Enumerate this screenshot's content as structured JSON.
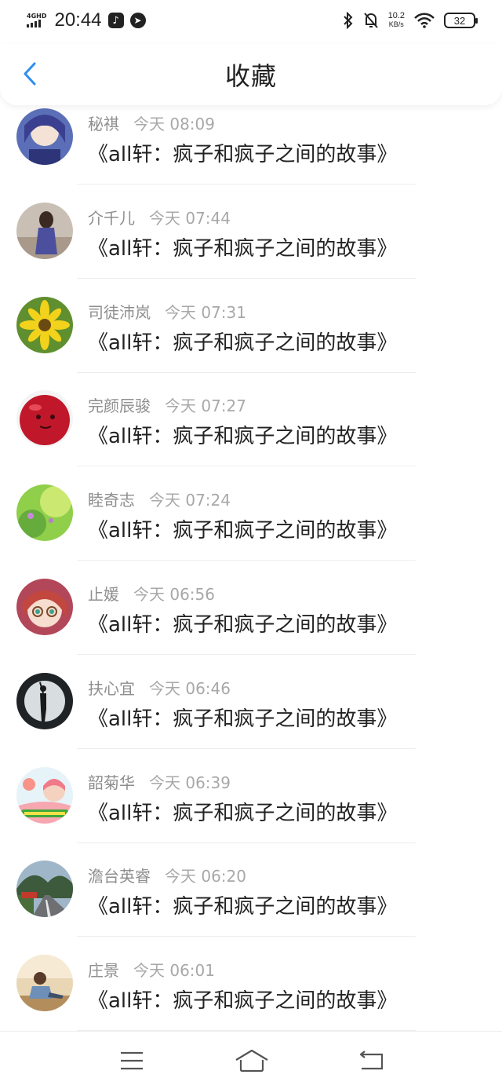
{
  "status_bar": {
    "network": "4GHD",
    "time": "20:44",
    "app_icon_1": "tiktok-icon",
    "app_icon_2": "navigation-app-icon",
    "net_speed_value": "10.2",
    "net_speed_unit": "KB/s",
    "battery": "32"
  },
  "header": {
    "title": "收藏",
    "back_icon": "chevron-left-icon",
    "accent_color": "#2f8ef0"
  },
  "items": [
    {
      "name": "秘祺",
      "time": "今天 08:09",
      "title": "《all轩：疯子和疯子之间的故事》"
    },
    {
      "name": "介千儿",
      "time": "今天 07:44",
      "title": "《all轩：疯子和疯子之间的故事》"
    },
    {
      "name": "司徒沛岚",
      "time": "今天 07:31",
      "title": "《all轩：疯子和疯子之间的故事》"
    },
    {
      "name": "完颜辰骏",
      "time": "今天 07:27",
      "title": "《all轩：疯子和疯子之间的故事》"
    },
    {
      "name": "睦奇志",
      "time": "今天 07:24",
      "title": "《all轩：疯子和疯子之间的故事》"
    },
    {
      "name": "止媛",
      "time": "今天 06:56",
      "title": "《all轩：疯子和疯子之间的故事》"
    },
    {
      "name": "扶心宜",
      "time": "今天 06:46",
      "title": "《all轩：疯子和疯子之间的故事》"
    },
    {
      "name": "韶菊华",
      "time": "今天 06:39",
      "title": "《all轩：疯子和疯子之间的故事》"
    },
    {
      "name": "澹台英睿",
      "time": "今天 06:20",
      "title": "《all轩：疯子和疯子之间的故事》"
    },
    {
      "name": "庄景",
      "time": "今天 06:01",
      "title": "《all轩：疯子和疯子之间的故事》"
    }
  ],
  "nav": {
    "menu_icon": "menu-icon",
    "home_icon": "home-icon",
    "back_icon": "back-arrow-icon"
  }
}
